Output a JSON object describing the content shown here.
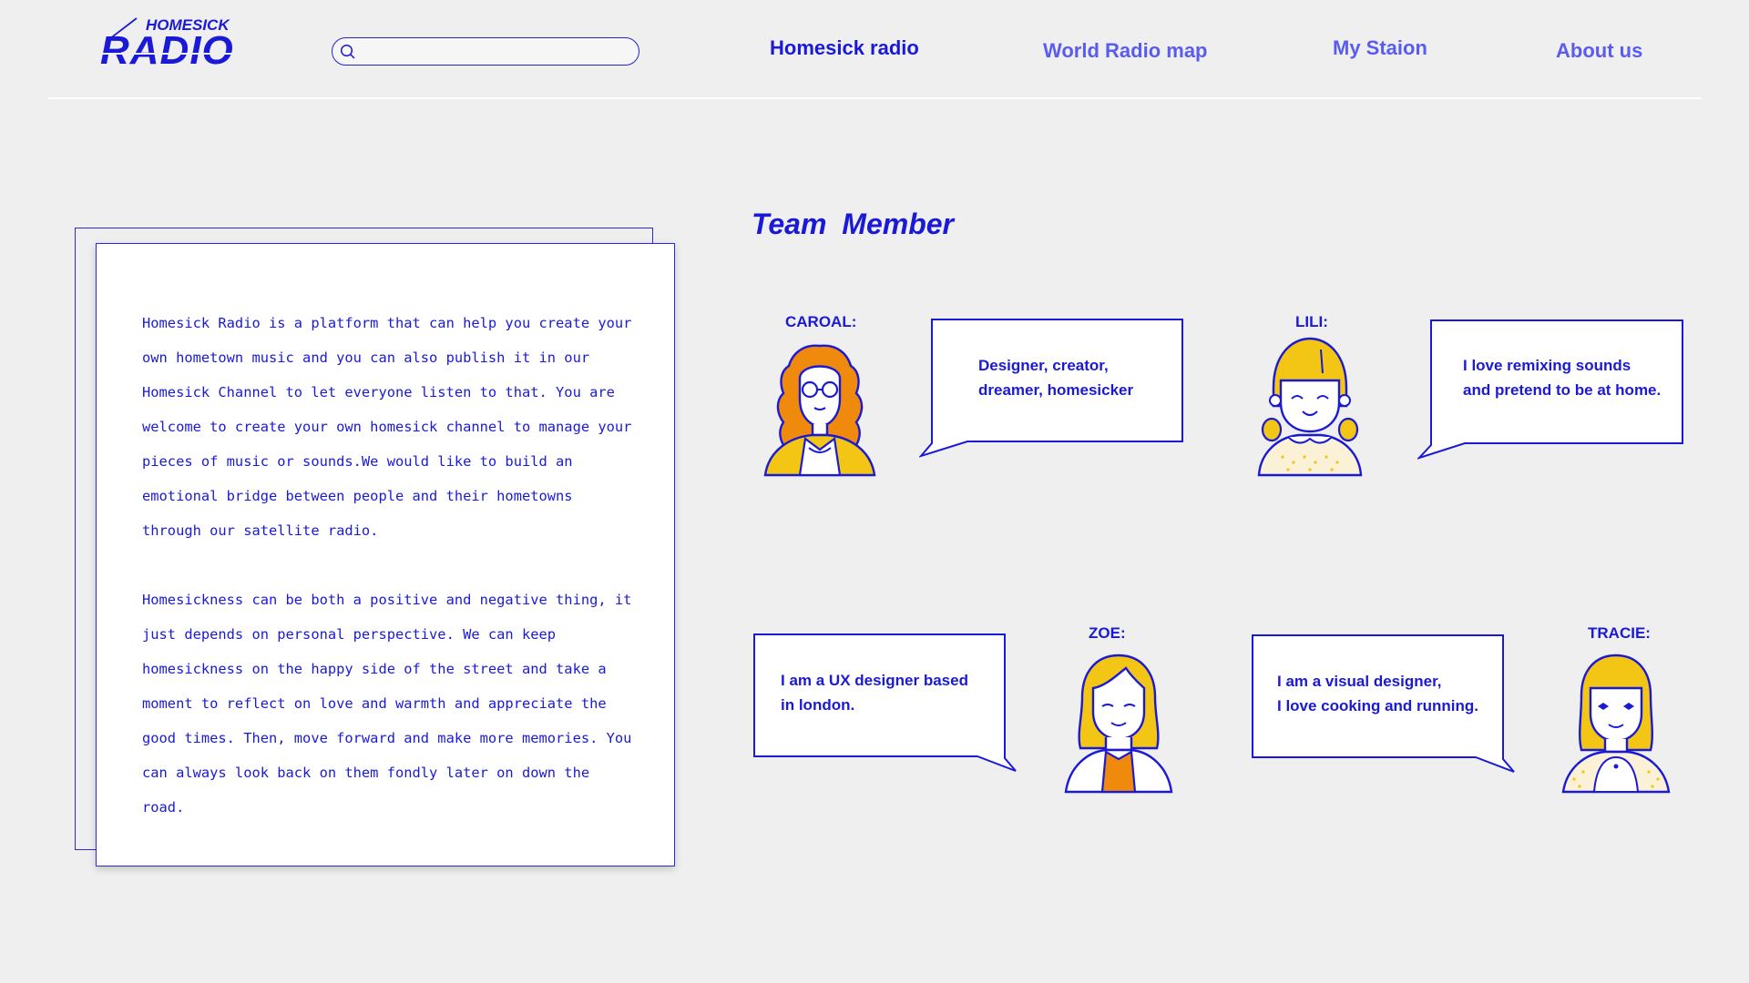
{
  "header": {
    "logo_top": "HOMESICK",
    "logo_bottom": "RADIO",
    "search": {
      "value": "",
      "placeholder": ""
    },
    "nav": [
      {
        "label": "Homesick radio",
        "active": true
      },
      {
        "label": "World Radio map",
        "active": false
      },
      {
        "label": "My Staion",
        "active": false
      },
      {
        "label": "About us",
        "active": false
      }
    ]
  },
  "about": {
    "paragraph1": "Homesick Radio is a platform that can help you create your own hometown music and you can also publish it in our Homesick Channel to let everyone listen to that. You are welcome to create your own homesick channel to manage your pieces of music or sounds.We would like to build an emotional bridge between people and their hometowns through our satellite radio.",
    "paragraph2": "Homesickness can be both a positive and negative thing, it just depends on personal perspective. We can keep homesickness on the happy side of the street and take a moment to reflect on love and warmth and appreciate the good times. Then, move forward and make more memories. You can always look back on them fondly later on down the road."
  },
  "team": {
    "title": "Team  Member",
    "members": [
      {
        "name": "CAROAL:",
        "quote": "Designer,  creator,\ndreamer,  homesicker"
      },
      {
        "name": "LILI:",
        "quote": "I love remixing sounds\nand pretend to be at home."
      },
      {
        "name": "ZOE:",
        "quote": "I am a UX designer based\nin london."
      },
      {
        "name": "TRACIE:",
        "quote": "I am a visual designer,\nI love cooking and running."
      }
    ]
  },
  "colors": {
    "primary": "#1a1ad6",
    "nav_inactive": "#5a5cf0",
    "accent_orange": "#f08a0c",
    "accent_yellow": "#f3c515",
    "background": "#efefef"
  },
  "icons": [
    "search-icon",
    "carol-avatar",
    "lili-avatar",
    "zoe-avatar",
    "tracie-avatar"
  ]
}
